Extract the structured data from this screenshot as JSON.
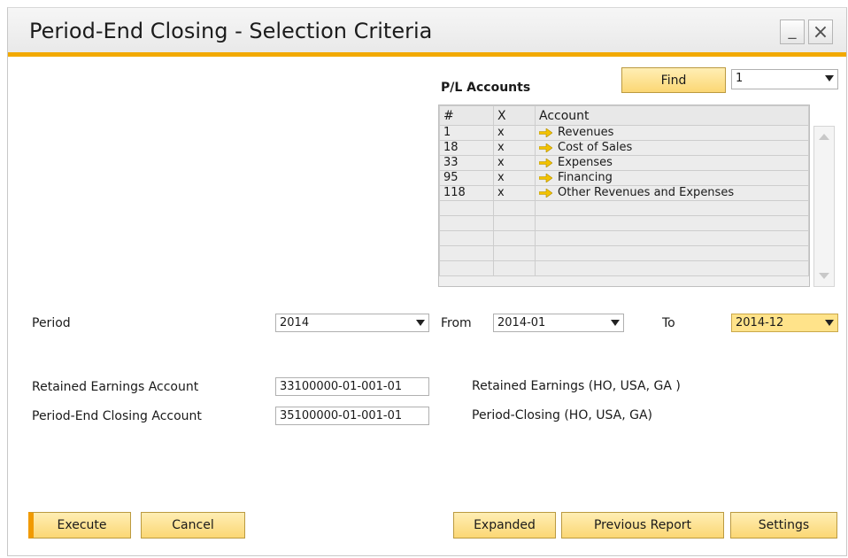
{
  "window": {
    "title": "Period-End Closing - Selection Criteria",
    "minimize_glyph": "_",
    "close_glyph": "×"
  },
  "find": {
    "button_label": "Find",
    "combo_value": "1"
  },
  "pl_accounts": {
    "title": "P/L Accounts",
    "columns": [
      "#",
      "X",
      "Account"
    ],
    "rows": [
      {
        "num": "1",
        "x": "x",
        "account": "Revenues"
      },
      {
        "num": "18",
        "x": "x",
        "account": "Cost of Sales"
      },
      {
        "num": "33",
        "x": "x",
        "account": "Expenses"
      },
      {
        "num": "95",
        "x": "x",
        "account": "Financing"
      },
      {
        "num": "118",
        "x": "x",
        "account": "Other Revenues and Expenses"
      }
    ]
  },
  "period": {
    "label": "Period",
    "value": "2014",
    "from_label": "From",
    "from_value": "2014-01",
    "to_label": "To",
    "to_value": "2014-12"
  },
  "retained": {
    "label": "Retained Earnings Account",
    "code": "33100000-01-001-01",
    "desc": "Retained Earnings (HO, USA, GA )"
  },
  "closing": {
    "label": "Period-End Closing Account",
    "code": "35100000-01-001-01",
    "desc": "Period-Closing (HO, USA, GA)"
  },
  "buttons": {
    "execute": "Execute",
    "cancel": "Cancel",
    "expanded": "Expanded",
    "previous_report": "Previous Report",
    "settings": "Settings"
  },
  "colors": {
    "accent": "#f2a900",
    "button": "#fbd774",
    "highlight_field": "#ffe38a"
  }
}
